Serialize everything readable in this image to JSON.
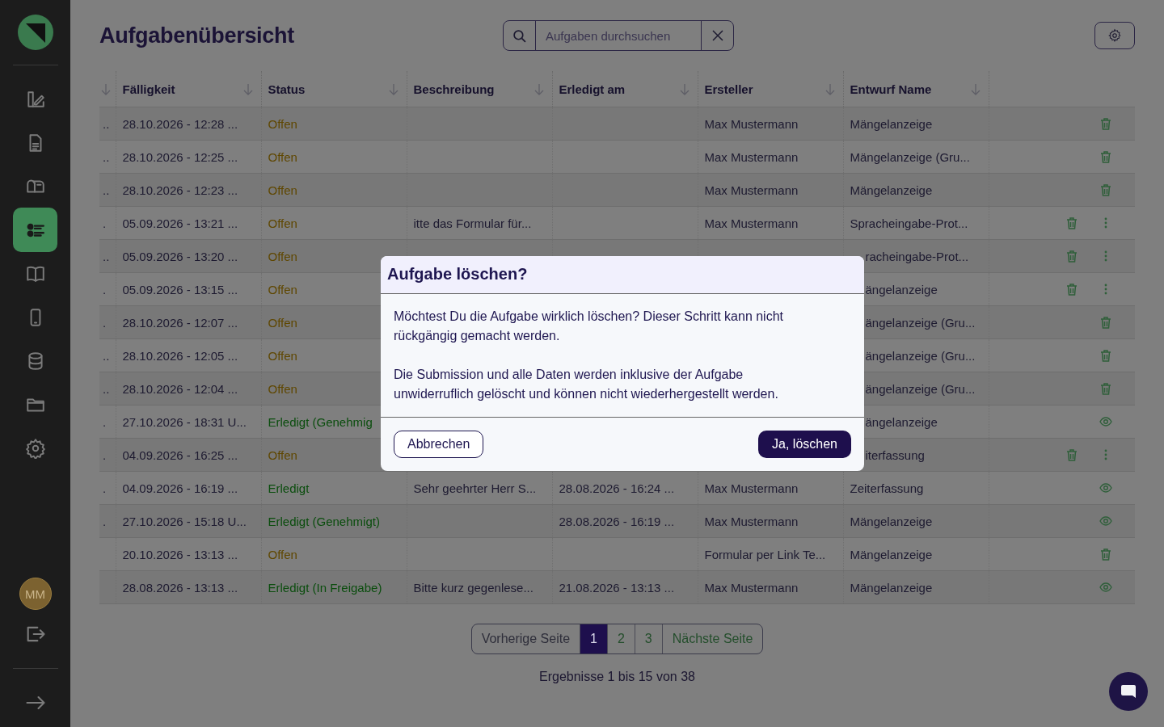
{
  "sidebar": {
    "items": [
      {
        "selected": false
      },
      {
        "selected": false
      },
      {
        "selected": false
      },
      {
        "selected": true
      },
      {
        "selected": false
      },
      {
        "selected": false
      },
      {
        "selected": false
      },
      {
        "selected": false
      },
      {
        "selected": false
      }
    ],
    "avatar": "MM"
  },
  "header": {
    "title": "Aufgabenübersicht",
    "search": {
      "placeholder": "Aufgaben durchsuchen"
    }
  },
  "table": {
    "columns": [
      {
        "label": "Fälligkeit"
      },
      {
        "label": "Status"
      },
      {
        "label": "Beschreibung"
      },
      {
        "label": "Erledigt am"
      },
      {
        "label": "Ersteller"
      },
      {
        "label": "Entwurf Name"
      }
    ],
    "rows": [
      {
        "column_1": "..",
        "faelligkeit": "28.10.2026 - 12:28 ...",
        "status": {
          "text": "Offen",
          "kind": "open"
        },
        "ersteller": "Max Mustermann",
        "entwurf_name": {
          "text": "Mängelanzeige"
        },
        "actions": [
          {
            "kind": "trash"
          }
        ]
      },
      {
        "column_1": "..",
        "faelligkeit": "28.10.2026 - 12:25 ...",
        "status": {
          "text": "Offen",
          "kind": "open"
        },
        "ersteller": "Max Mustermann",
        "entwurf_name": {
          "text": "Mängelanzeige (Gru..."
        },
        "actions": [
          {
            "kind": "trash"
          }
        ]
      },
      {
        "column_1": "..",
        "faelligkeit": "28.10.2026 - 12:23 ...",
        "status": {
          "text": "Offen",
          "kind": "open"
        },
        "ersteller": "Max Mustermann",
        "entwurf_name": {
          "text": "Mängelanzeige"
        },
        "actions": [
          {
            "kind": "trash"
          }
        ]
      },
      {
        "column_1": ".",
        "faelligkeit": "05.09.2026 - 13:21 ...",
        "status": {
          "text": "Offen",
          "kind": "open"
        },
        "beschreibung": "itte das Formular für...",
        "ersteller": "Max Mustermann",
        "entwurf_name": {
          "text": "Spracheingabe-Prot..."
        },
        "actions": [
          {
            "kind": "trash"
          },
          {
            "kind": "more"
          }
        ]
      },
      {
        "column_1": "..",
        "faelligkeit": "05.09.2026 - 13:20 ...",
        "status": {
          "text": "Offen",
          "kind": "open"
        },
        "entwurf_name": {
          "text": "racheingabe-Prot...",
          "covered": true
        },
        "actions": [
          {
            "kind": "trash"
          },
          {
            "kind": "more"
          }
        ]
      },
      {
        "column_1": ".",
        "faelligkeit": "05.09.2026 - 13:15 ...",
        "status": {
          "text": "Offen",
          "kind": "open"
        },
        "entwurf_name": {
          "text": "ängelanzeige",
          "covered": true
        },
        "actions": [
          {
            "kind": "trash"
          },
          {
            "kind": "more"
          }
        ]
      },
      {
        "column_1": ".",
        "faelligkeit": "28.10.2026 - 12:07 ...",
        "status": {
          "text": "Offen",
          "kind": "open"
        },
        "entwurf_name": {
          "text": "ängelanzeige (Gru...",
          "covered": true
        },
        "actions": [
          {
            "kind": "trash"
          }
        ]
      },
      {
        "column_1": "..",
        "faelligkeit": "28.10.2026 - 12:05 ...",
        "status": {
          "text": "Offen",
          "kind": "open"
        },
        "entwurf_name": {
          "text": "ängelanzeige (Gru...",
          "covered": true
        },
        "actions": [
          {
            "kind": "trash"
          }
        ]
      },
      {
        "column_1": "..",
        "faelligkeit": "28.10.2026 - 12:04 ...",
        "status": {
          "text": "Offen",
          "kind": "open"
        },
        "entwurf_name": {
          "text": "ängelanzeige (Gru...",
          "covered": true
        },
        "actions": [
          {
            "kind": "trash"
          }
        ]
      },
      {
        "column_1": ".",
        "faelligkeit": "27.10.2026 - 18:31 U...",
        "status": {
          "text": "Erledigt (Genehmig",
          "kind": "done"
        },
        "entwurf_name": {
          "text": "ängelanzeige",
          "covered": true
        },
        "actions": [
          {
            "kind": "eye"
          }
        ]
      },
      {
        "column_1": ".",
        "faelligkeit": "04.09.2026 - 16:25 ...",
        "status": {
          "text": "Offen",
          "kind": "open"
        },
        "entwurf_name": {
          "text": "iterfassung",
          "covered": true
        },
        "actions": [
          {
            "kind": "trash"
          },
          {
            "kind": "more"
          }
        ]
      },
      {
        "column_1": ".",
        "faelligkeit": "04.09.2026 - 16:19 ...",
        "status": {
          "text": "Erledigt",
          "kind": "done"
        },
        "beschreibung": "Sehr geehrter Herr S...",
        "erledigt_am": "28.08.2026 - 16:24 ...",
        "ersteller": "Max Mustermann",
        "entwurf_name": {
          "text": "Zeiterfassung"
        },
        "actions": [
          {
            "kind": "eye"
          }
        ]
      },
      {
        "column_1": ".",
        "faelligkeit": "27.10.2026 - 15:18 U...",
        "status": {
          "text": "Erledigt (Genehmigt)",
          "kind": "done"
        },
        "erledigt_am": "28.08.2026 - 16:19 ...",
        "ersteller": "Max Mustermann",
        "entwurf_name": {
          "text": "Mängelanzeige"
        },
        "actions": [
          {
            "kind": "eye"
          }
        ]
      },
      {
        "faelligkeit": "20.10.2026 - 13:13 ...",
        "status": {
          "text": "Offen",
          "kind": "open"
        },
        "ersteller": "Formular per Link Te...",
        "entwurf_name": {
          "text": "Mängelanzeige"
        },
        "actions": [
          {
            "kind": "trash"
          }
        ]
      },
      {
        "faelligkeit": "28.08.2026 - 13:13 ...",
        "status": {
          "text": "Erledigt (In Freigabe)",
          "kind": "done"
        },
        "beschreibung": "Bitte kurz gegenlese...",
        "erledigt_am": "21.08.2026 - 13:13 ...",
        "ersteller": "Max Mustermann",
        "entwurf_name": {
          "text": "Mängelanzeige"
        },
        "actions": [
          {
            "kind": "eye"
          }
        ]
      }
    ]
  },
  "pagination": {
    "previous": "Vorherige Seite",
    "pages": [
      {
        "label": "1",
        "selected": true
      },
      {
        "label": "2",
        "selected": false
      },
      {
        "label": "3",
        "selected": false
      }
    ],
    "next": "Nächste Seite",
    "results": "Ergebnisse 1 bis 15 von 38"
  },
  "dialog": {
    "title": "Aufgabe löschen?",
    "paragraphs": [
      "Möchtest Du die Aufgabe wirklich löschen? Dieser Schritt kann nicht rückgängig gemacht werden.",
      "Die Submission und alle Daten werden inklusive der Aufgabe unwiderruflich gelöscht und können nicht wiederhergestellt werden."
    ],
    "cancel": "Abbrechen",
    "confirm": "Ja, löschen"
  }
}
